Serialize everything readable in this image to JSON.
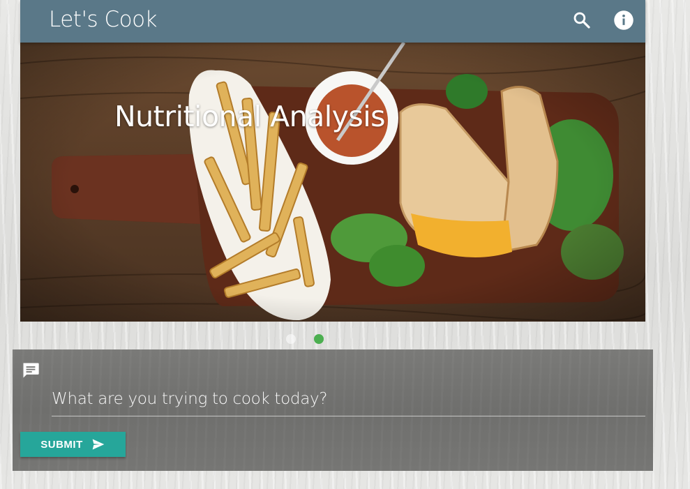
{
  "app": {
    "title": "Let's Cook"
  },
  "toolbar": {
    "search_icon": "search-icon",
    "info_icon": "info-icon"
  },
  "hero": {
    "title": "Nutritional Analysis",
    "image_subject": "grilled sandwich, fries, dip, salad on wooden board"
  },
  "carousel": {
    "total": 2,
    "active_index": 1
  },
  "chat": {
    "icon": "chat-message-icon",
    "input_value": "",
    "placeholder": "What are you trying to cook today?",
    "submit_label": "SUBMIT",
    "submit_icon": "send-icon"
  },
  "colors": {
    "app_bar": "#5a7888",
    "accent": "#26a69a",
    "active_dot": "#4caf50"
  }
}
